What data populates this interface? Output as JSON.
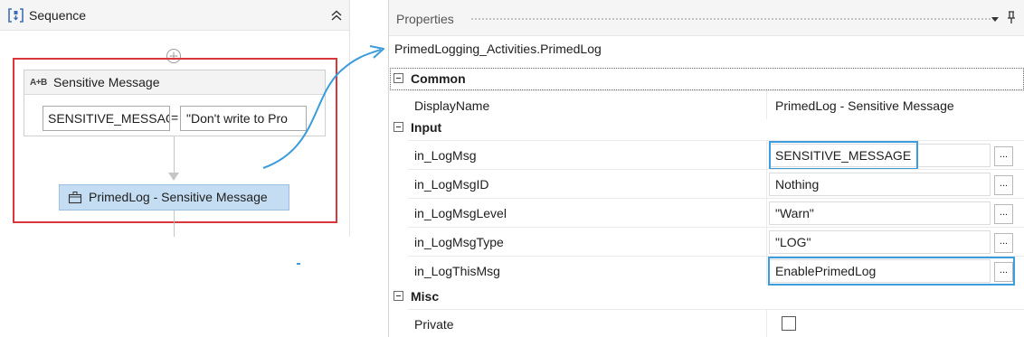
{
  "designer": {
    "sequence_title": "Sequence",
    "assign": {
      "title": "Sensitive Message",
      "badge": "A+B",
      "left_value": "SENSITIVE_MESSAGE",
      "operator": "=",
      "right_value": "\"Don't write to Pro"
    },
    "primed_activity_label": "PrimedLog - Sensitive Message"
  },
  "properties": {
    "panel_title": "Properties",
    "type_name": "PrimedLogging_Activities.PrimedLog",
    "ellipsis_label": "...",
    "categories": {
      "common": {
        "label": "Common"
      },
      "input": {
        "label": "Input"
      },
      "misc": {
        "label": "Misc"
      }
    },
    "rows": {
      "display_name": {
        "name": "DisplayName",
        "value": "PrimedLog - Sensitive Message"
      },
      "in_logmsg": {
        "name": "in_LogMsg",
        "value": "SENSITIVE_MESSAGE"
      },
      "in_logmsgid": {
        "name": "in_LogMsgID",
        "value": "Nothing"
      },
      "in_logmsglevel": {
        "name": "in_LogMsgLevel",
        "value": "\"Warn\""
      },
      "in_logmsgtype": {
        "name": "in_LogMsgType",
        "value": "\"LOG\""
      },
      "in_logthismsg": {
        "name": "in_LogThisMsg",
        "value": "EnablePrimedLog"
      },
      "private": {
        "name": "Private",
        "checked": false
      }
    }
  },
  "colors": {
    "selection_red": "#d9373b",
    "highlight_blue": "#3c9cdc",
    "activity_fill": "#c4ddf2"
  }
}
